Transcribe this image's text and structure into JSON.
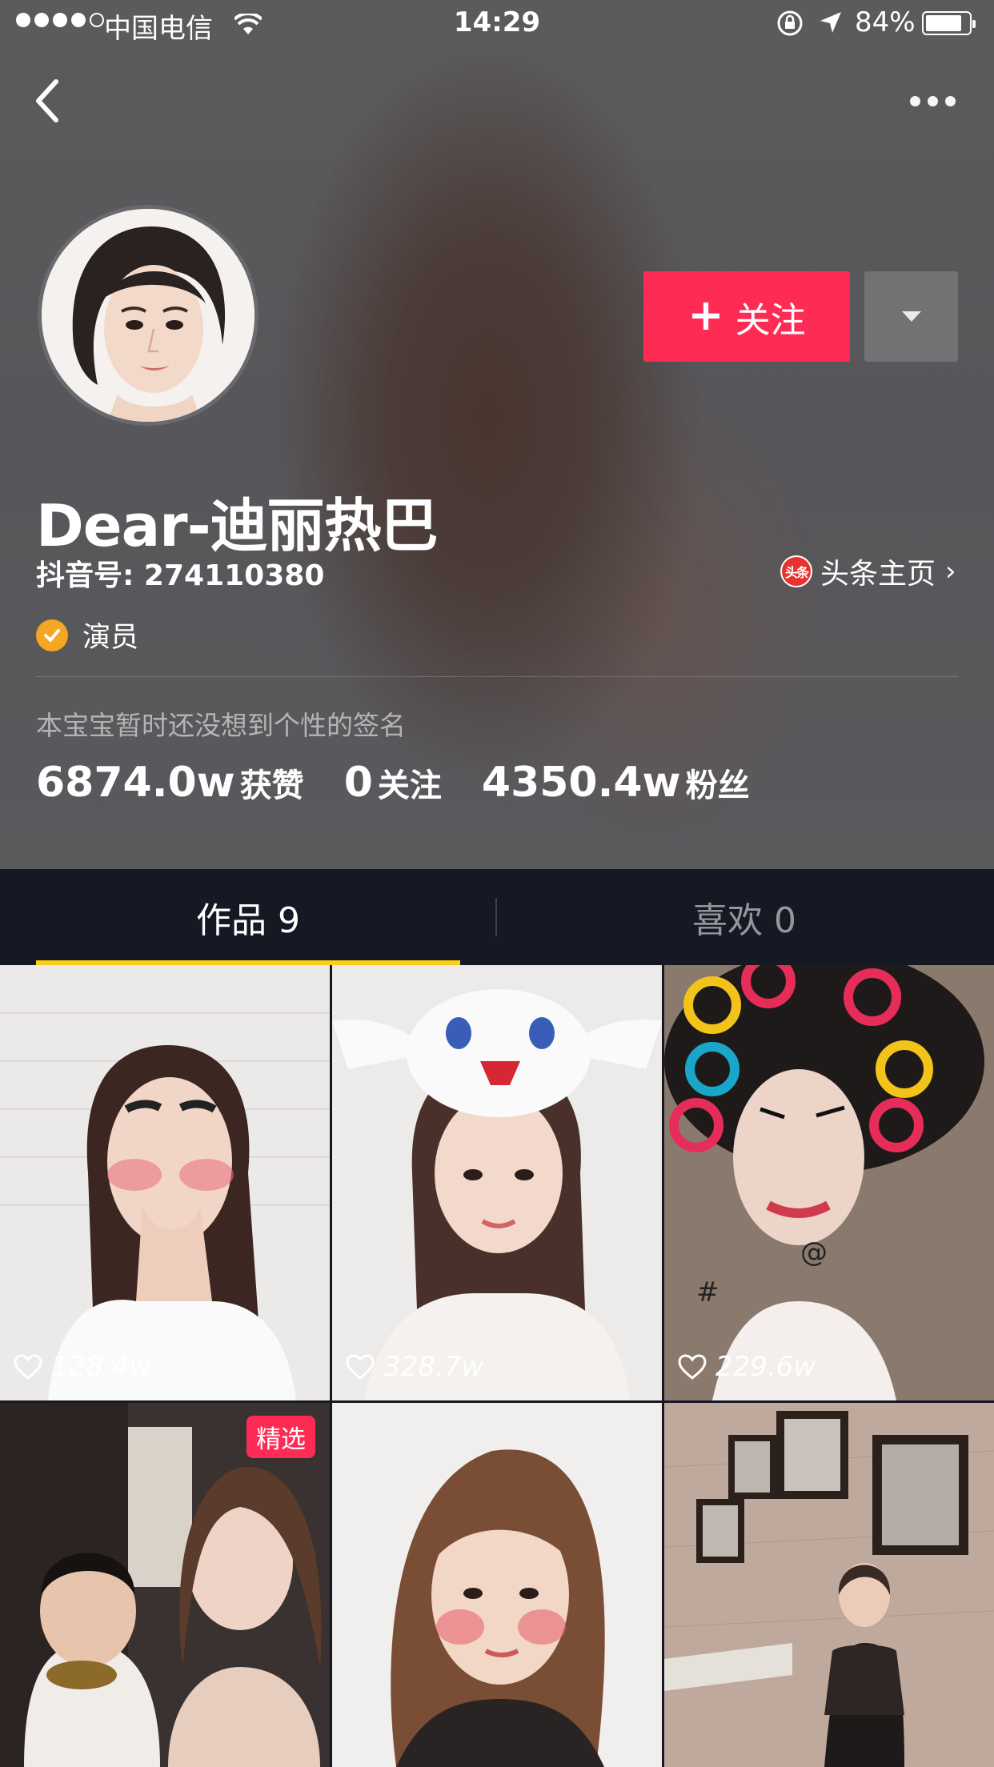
{
  "status_bar": {
    "carrier": "中国电信",
    "time": "14:29",
    "battery": "84%",
    "battery_level": 0.84
  },
  "profile": {
    "username": "Dear-迪丽热巴",
    "douyin_id": "抖音号: 274110380",
    "toutiao_logo": "头条",
    "toutiao_link": "头条主页",
    "verified_label": "演员",
    "signature": "本宝宝暂时还没想到个性的签名",
    "stats": [
      {
        "value": "6874.0w",
        "label": "获赞"
      },
      {
        "value": "0",
        "label": "关注"
      },
      {
        "value": "4350.4w",
        "label": "粉丝"
      }
    ]
  },
  "actions": {
    "follow_label": "关注",
    "follow_plus": "+"
  },
  "tabs": [
    {
      "label": "作品 9",
      "active": true
    },
    {
      "label": "喜欢 0",
      "active": false
    }
  ],
  "videos": [
    {
      "likes": "128.4w"
    },
    {
      "likes": "328.7w"
    },
    {
      "likes": "229.6w"
    },
    {
      "badge": "精选"
    },
    {},
    {}
  ],
  "colors": {
    "accent": "#fe2c55",
    "tab_indicator": "#face15",
    "verified": "#f5a623",
    "dark_bg": "#161823"
  }
}
